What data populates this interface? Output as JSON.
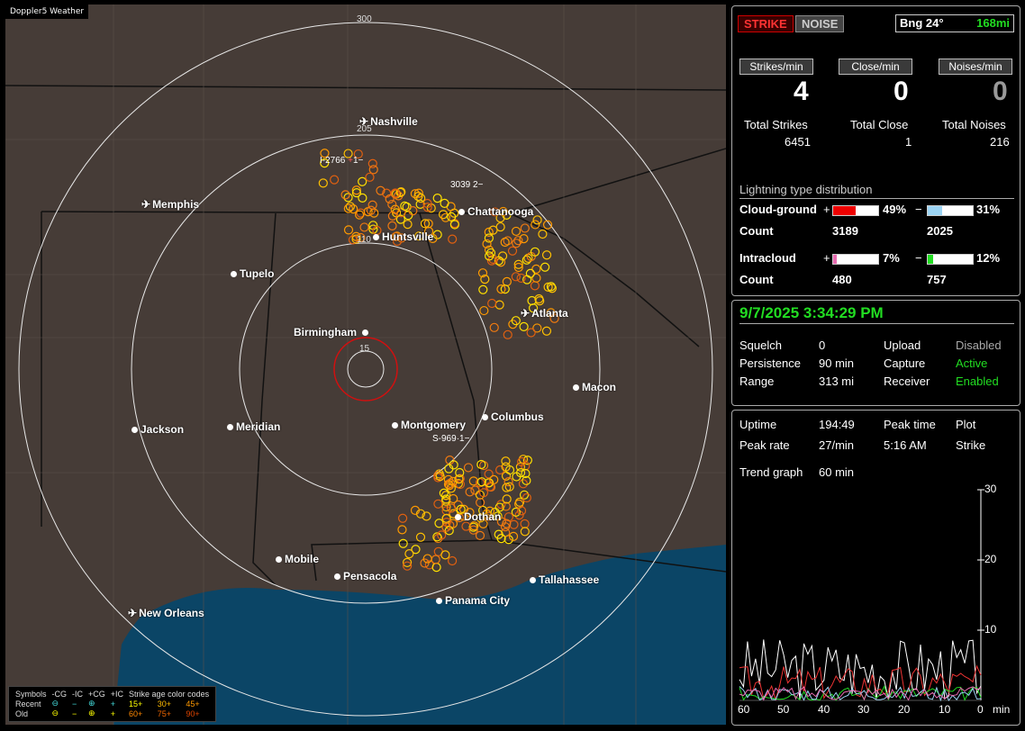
{
  "map": {
    "title": "Doppler5 Weather",
    "ring_labels": [
      "300",
      "205",
      "110",
      "15"
    ],
    "cities": [
      {
        "name": "Nashville",
        "airport": true
      },
      {
        "name": "Memphis",
        "airport": true
      },
      {
        "name": "Chattanooga",
        "airport": false
      },
      {
        "name": "Huntsville",
        "airport": false
      },
      {
        "name": "Tupelo",
        "airport": false
      },
      {
        "name": "Birmingham",
        "airport": false
      },
      {
        "name": "Atlanta",
        "airport": true
      },
      {
        "name": "Macon",
        "airport": false
      },
      {
        "name": "Jackson",
        "airport": false
      },
      {
        "name": "Meridian",
        "airport": false
      },
      {
        "name": "Montgomery",
        "airport": false
      },
      {
        "name": "Columbus",
        "airport": false
      },
      {
        "name": "Dothan",
        "airport": false
      },
      {
        "name": "Mobile",
        "airport": false
      },
      {
        "name": "Pensacola",
        "airport": false
      },
      {
        "name": "Tallahassee",
        "airport": false
      },
      {
        "name": "Panama City",
        "airport": false
      },
      {
        "name": "New Orleans",
        "airport": true
      }
    ],
    "strike_ids": [
      "I-2766",
      "1",
      "3039",
      "2",
      "S-969",
      "1"
    ],
    "legend": {
      "header": [
        "Symbols",
        "-CG",
        "-IC",
        "+CG",
        "+IC",
        "Strike age color codes"
      ],
      "recent_label": "Recent",
      "old_label": "Old",
      "recent_ages": [
        "15+",
        "30+",
        "45+"
      ],
      "old_ages": [
        "60+",
        "75+",
        "90+"
      ]
    }
  },
  "panel1": {
    "strike_btn": "STRIKE",
    "noise_btn": "NOISE",
    "bearing": "Bng 24°",
    "distance": "168mi",
    "rate_labels": [
      "Strikes/min",
      "Close/min",
      "Noises/min"
    ],
    "rates": [
      "4",
      "0",
      "0"
    ],
    "total_labels": [
      "Total Strikes",
      "Total Close",
      "Total Noises"
    ],
    "totals": [
      "6451",
      "1",
      "216"
    ],
    "dist_title": "Lightning type distribution",
    "cg_label": "Cloud-ground",
    "ic_label": "Intracloud",
    "count_label": "Count",
    "plus": "+",
    "minus": "−",
    "cg_pos_pct": "49%",
    "cg_neg_pct": "31%",
    "cg_pos_count": "3189",
    "cg_neg_count": "2025",
    "ic_pos_pct": "7%",
    "ic_neg_pct": "12%",
    "ic_pos_count": "480",
    "ic_neg_count": "757",
    "cg_pos_frac": 0.49,
    "cg_neg_frac": 0.31,
    "ic_pos_frac": 0.07,
    "ic_neg_frac": 0.12
  },
  "panel2": {
    "datetime": "9/7/2025 3:34:29 PM",
    "rows": [
      {
        "l1": "Squelch",
        "v1": "0",
        "l2": "Upload",
        "v2": "Disabled"
      },
      {
        "l1": "Persistence",
        "v1": "90 min",
        "l2": "Capture",
        "v2": "Active"
      },
      {
        "l1": "Range",
        "v1": "313 mi",
        "l2": "Receiver",
        "v2": "Enabled"
      }
    ]
  },
  "panel3": {
    "uptime_label": "Uptime",
    "uptime": "194:49",
    "peak_time_label": "Peak time",
    "plot_label": "Plot",
    "peak_rate_label": "Peak rate",
    "peak_rate": "27/min",
    "peak_time": "5:16 AM",
    "plot": "Strike",
    "trend_label": "Trend graph",
    "trend_value": "60 min",
    "y_ticks": [
      "30",
      "20",
      "10"
    ],
    "x_ticks": [
      "60",
      "50",
      "40",
      "30",
      "20",
      "10",
      "0"
    ],
    "x_unit": "min"
  }
}
